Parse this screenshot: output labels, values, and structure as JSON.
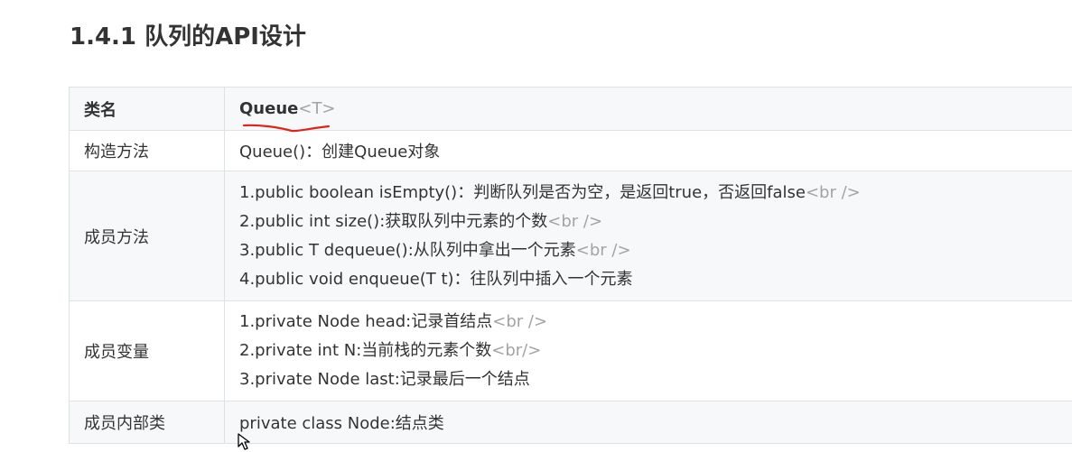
{
  "heading": "1.4.1 队列的API设计",
  "table": {
    "class_name_label": "类名",
    "class_name": "Queue",
    "class_generic": "<T>",
    "ctor_label": "构造方法",
    "ctor_value": "Queue()：创建Queue对象",
    "methods_label": "成员方法",
    "methods": [
      {
        "text": "1.public boolean isEmpty()：判断队列是否为空，是返回true，否返回false",
        "tag": "<br />"
      },
      {
        "text": "2.public int size():获取队列中元素的个数",
        "tag": "<br />"
      },
      {
        "text": "3.public T dequeue():从队列中拿出一个元素",
        "tag": "<br />"
      },
      {
        "text": "4.public void enqueue(T t)：往队列中插入一个元素",
        "tag": ""
      }
    ],
    "fields_label": "成员变量",
    "fields": [
      {
        "text": "1.private Node head:记录首结点",
        "tag": "<br />"
      },
      {
        "text": "2.private int N:当前栈的元素个数",
        "tag": "<br/>"
      },
      {
        "text": "3.private Node last:记录最后一个结点",
        "tag": ""
      }
    ],
    "inner_label": "成员内部类",
    "inner_value": "private class Node:结点类"
  },
  "colors": {
    "text": "#333333",
    "tag_gray": "#a3a3a3",
    "row_stripe": "#f6f8fa",
    "border": "#dfe2e5",
    "annotation_red": "#e0241c"
  },
  "icons": {
    "annotation": "red-underline-mark",
    "cursor": "mouse-pointer-icon"
  }
}
